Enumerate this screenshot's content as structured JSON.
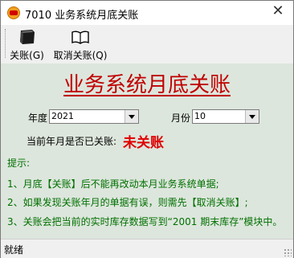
{
  "window": {
    "title": "7010 业务系统月底关账",
    "close_glyph": "✕"
  },
  "toolbar": {
    "close_account_label": "关账(G)",
    "cancel_close_label": "取消关账(Q)"
  },
  "main": {
    "heading": "业务系统月底关账",
    "year_label": "年度",
    "year_value": "2021",
    "month_label": "月份",
    "month_value": "10",
    "status_label": "当前年月是否已关账:",
    "status_value": "未关账"
  },
  "tips": {
    "title": "提示:",
    "items": [
      "1、月底【关账】后不能再改动本月业务系统单据;",
      "2、如果发现关账年月的单据有误，则需先【取消关账】;",
      "3、关账会把当前的实时库存数据写到“2001 期末库存”模块中。"
    ]
  },
  "statusbar": {
    "text": "就绪"
  },
  "colors": {
    "accent_red": "#c00000",
    "status_red": "#e00000",
    "tip_green": "#007000",
    "panel_bg": "#dde6dd"
  }
}
